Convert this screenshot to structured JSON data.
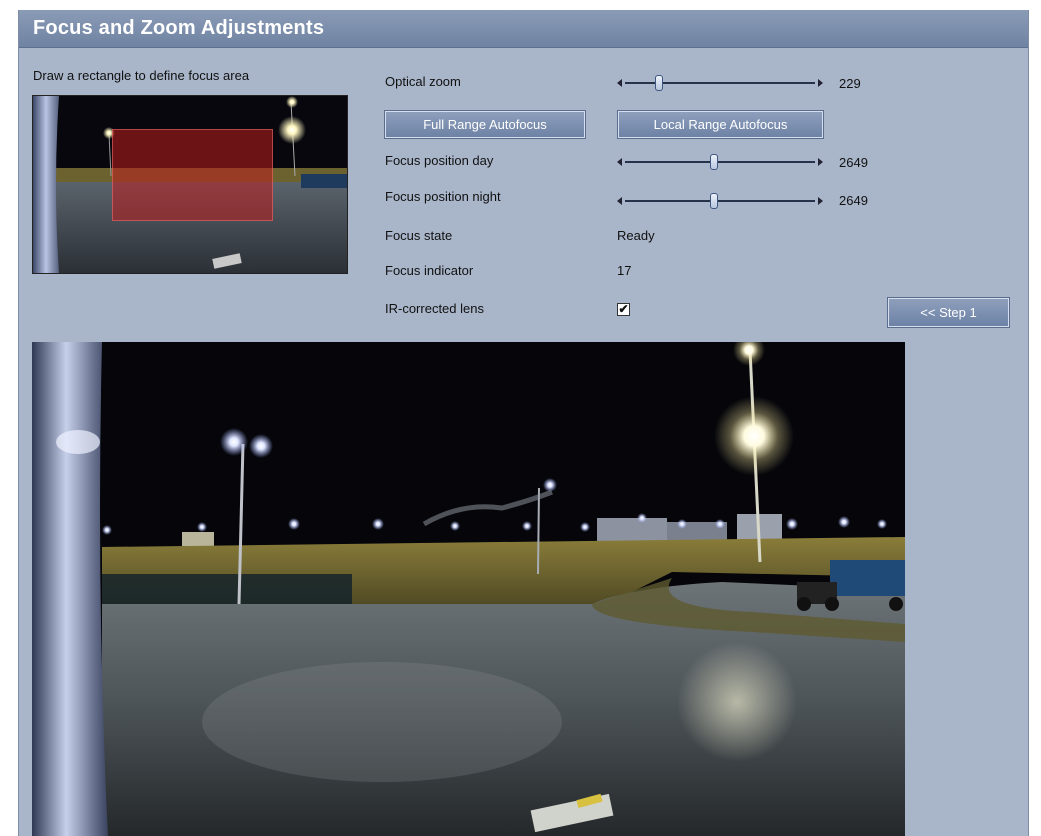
{
  "title": "Focus and Zoom Adjustments",
  "focus_area_hint": "Draw a rectangle to define focus area",
  "optical_zoom": {
    "label": "Optical zoom",
    "value": "229",
    "fraction": 0.18
  },
  "buttons": {
    "full_range_autofocus": "Full Range Autofocus",
    "local_range_autofocus": "Local Range Autofocus",
    "step_back": "<< Step 1"
  },
  "focus_position_day": {
    "label": "Focus position day",
    "value": "2649",
    "fraction": 0.47
  },
  "focus_position_night": {
    "label": "Focus position night",
    "value": "2649",
    "fraction": 0.47
  },
  "focus_state": {
    "label": "Focus state",
    "value": "Ready"
  },
  "focus_indicator": {
    "label": "Focus indicator",
    "value": "17"
  },
  "ir_corrected_lens": {
    "label": "IR-corrected lens",
    "checked": true
  },
  "colors": {
    "panel_bg": "#a9b6ca",
    "title_bar": "#7a8dab",
    "button_bg": "#7d90b0",
    "focus_rect": "#be1e1e"
  }
}
